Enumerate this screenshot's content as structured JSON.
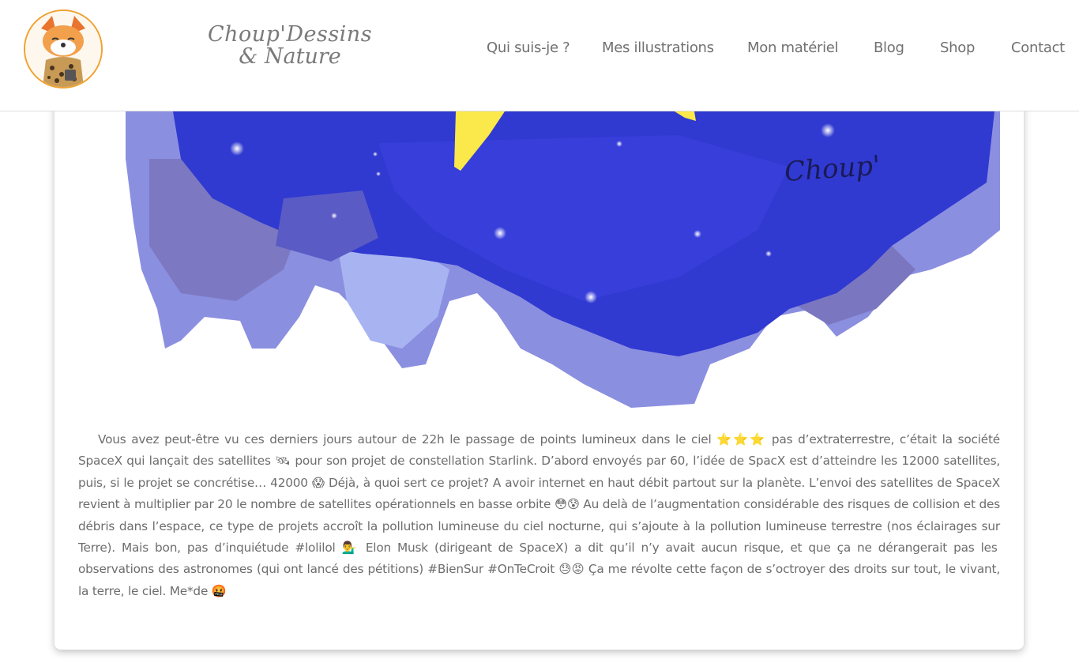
{
  "site": {
    "brand_line1": "Choup'Dessins",
    "brand_line2": "& Nature",
    "avatar_icon": "fox-mascot-avatar"
  },
  "nav": {
    "items": [
      {
        "label": "Qui suis-je ?"
      },
      {
        "label": "Mes illustrations"
      },
      {
        "label": "Mon matériel"
      },
      {
        "label": "Blog"
      },
      {
        "label": "Shop"
      },
      {
        "label": "Contact"
      }
    ]
  },
  "illustration": {
    "signature": "Choup'",
    "colors": {
      "deep": "#2e37d4",
      "mid": "#5a5fd0",
      "light": "#8f95e4",
      "star": "#fbe84a"
    }
  },
  "post": {
    "paragraph": "Vous avez peut-être vu ces derniers jours autour de 22h le passage de points lumineux dans le ciel ⭐⭐⭐ pas d’extraterrestre, c’était la société SpaceX qui lançait des satellites 🛰 pour son projet de constellation Starlink. D’abord envoyés par 60, l’idée de SpacX est d’atteindre les 12000 satellites, puis, si le projet se concrétise… 42000 😱 Déjà, à quoi sert ce projet? A avoir internet en haut débit partout sur la planète. L’envoi des satellites de SpaceX revient à multiplier par 20 le nombre de satellites opérationnels en basse orbite 😳😰 Au delà de l’augmentation considérable des risques de collision et des débris dans l’espace, ce type de projets accroît la pollution lumineuse du ciel nocturne, qui s’ajoute à la pollution lumineuse terrestre (nos éclairages sur Terre). Mais bon, pas d’inquiétude #lolilol 💁‍♂️ Elon Musk (dirigeant de SpaceX) a dit qu’il n’y avait aucun risque, et que ça ne dérangerait pas les observations des astronomes (qui ont lancé des pétitions) #BienSur #OnTeCroit 😓😡 Ça me révolte cette façon de s’octroyer des droits sur tout, le vivant, la terre, le ciel. Me*de 🤬"
  }
}
